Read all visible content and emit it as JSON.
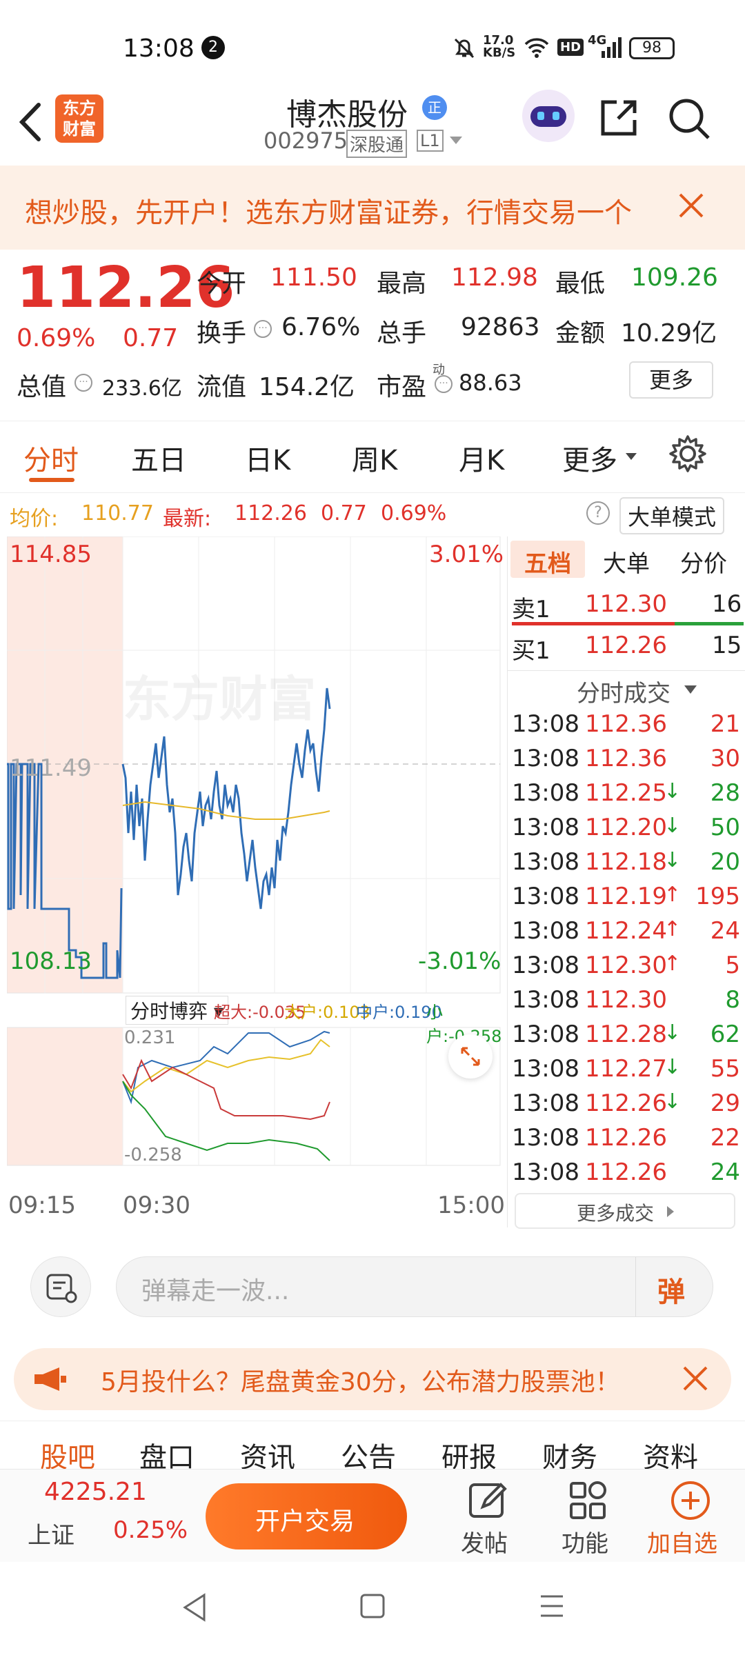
{
  "status": {
    "time": "13:08",
    "notif_count": "2",
    "net_speed_top": "17.0",
    "net_speed_unit": "KB/S",
    "hd": "HD",
    "signal": "4G",
    "battery": "98"
  },
  "header": {
    "logo_line1": "东方",
    "logo_line2": "财富",
    "stock_name": "博杰股份",
    "badge": "正",
    "code": "002975",
    "market": "深股通",
    "level": "L1"
  },
  "banner": {
    "text": "想炒股，先开户！选东方财富证券，行情交易一个"
  },
  "quote": {
    "price": "112.26",
    "change_pct": "0.69%",
    "change_amt": "0.77",
    "open_label": "今开",
    "open": "111.50",
    "high_label": "最高",
    "high": "112.98",
    "low_label": "最低",
    "low": "109.26",
    "turnover_label": "换手",
    "turnover": "6.76%",
    "volume_label": "总手",
    "volume": "92863",
    "amount_label": "金额",
    "amount": "10.29亿",
    "mktcap_label": "总值",
    "mktcap": "233.6亿",
    "float_label": "流值",
    "float": "154.2亿",
    "pe_label": "市盈",
    "pe_sup": "动",
    "pe": "88.63",
    "more": "更多"
  },
  "tabs": {
    "items": [
      "分时",
      "五日",
      "日K",
      "周K",
      "月K",
      "更多"
    ],
    "active": "分时"
  },
  "infoline": {
    "avg_label": "均价:",
    "avg": "110.77",
    "latest_label": "最新:",
    "latest": "112.26",
    "chg": "0.77",
    "pct": "0.69%",
    "bigorder": "大单模式"
  },
  "chart": {
    "y_top": "114.85",
    "y_mid": "111.49",
    "y_bottom": "108.13",
    "pct_top": "3.01%",
    "pct_bottom": "-3.01%",
    "watermark": "东方财富",
    "game_label": "分时博弈",
    "super_label": "超大:-0.035",
    "big_label": "大户:0.103",
    "mid_label": "中户:0.190",
    "small_label": "小户:-0.258",
    "sub_top": "0.231",
    "sub_bottom": "-0.258",
    "time_start": "09:15",
    "time_mid": "09:30",
    "time_end": "15:00",
    "colors": {
      "price": "#2f6db5",
      "avg": "#e6b82a",
      "super": "#c93a3a",
      "big": "#e6c12a",
      "mid": "#2f6db5",
      "small": "#1f9a2e"
    }
  },
  "side": {
    "tabs": [
      "五档",
      "大单",
      "分价"
    ],
    "sell1_label": "卖1",
    "sell1_price": "112.30",
    "sell1_vol": "16",
    "buy1_label": "买1",
    "buy1_price": "112.26",
    "buy1_vol": "15",
    "ticks_title": "分时成交",
    "ticks": [
      {
        "t": "13:08",
        "p": "112.36",
        "a": "",
        "v": "21",
        "c": "red"
      },
      {
        "t": "13:08",
        "p": "112.36",
        "a": "",
        "v": "30",
        "c": "red"
      },
      {
        "t": "13:08",
        "p": "112.25",
        "a": "↓",
        "v": "28",
        "c": "green"
      },
      {
        "t": "13:08",
        "p": "112.20",
        "a": "↓",
        "v": "50",
        "c": "green"
      },
      {
        "t": "13:08",
        "p": "112.18",
        "a": "↓",
        "v": "20",
        "c": "green"
      },
      {
        "t": "13:08",
        "p": "112.19",
        "a": "↑",
        "v": "195",
        "c": "red"
      },
      {
        "t": "13:08",
        "p": "112.24",
        "a": "↑",
        "v": "24",
        "c": "red"
      },
      {
        "t": "13:08",
        "p": "112.30",
        "a": "↑",
        "v": "5",
        "c": "red"
      },
      {
        "t": "13:08",
        "p": "112.30",
        "a": "",
        "v": "8",
        "c": "green"
      },
      {
        "t": "13:08",
        "p": "112.28",
        "a": "↓",
        "v": "62",
        "c": "green"
      },
      {
        "t": "13:08",
        "p": "112.27",
        "a": "↓",
        "v": "55",
        "c": "red"
      },
      {
        "t": "13:08",
        "p": "112.26",
        "a": "↓",
        "v": "29",
        "c": "red"
      },
      {
        "t": "13:08",
        "p": "112.26",
        "a": "",
        "v": "22",
        "c": "red"
      },
      {
        "t": "13:08",
        "p": "112.26",
        "a": "",
        "v": "24",
        "c": "green"
      }
    ],
    "more_ticks": "更多成交"
  },
  "comment": {
    "placeholder": "弹幕走一波...",
    "danmu": "弹"
  },
  "promo": {
    "text": "5月投什么？尾盘黄金30分，公布潜力股票池！"
  },
  "subtabs": [
    "股吧",
    "盘口",
    "资讯",
    "公告",
    "研报",
    "财务",
    "资料"
  ],
  "bottom": {
    "index_value": "4225.21",
    "index_name": "上证",
    "index_pct": "0.25%",
    "trade": "开户交易",
    "post": "发帖",
    "func": "功能",
    "add": "加自选"
  }
}
